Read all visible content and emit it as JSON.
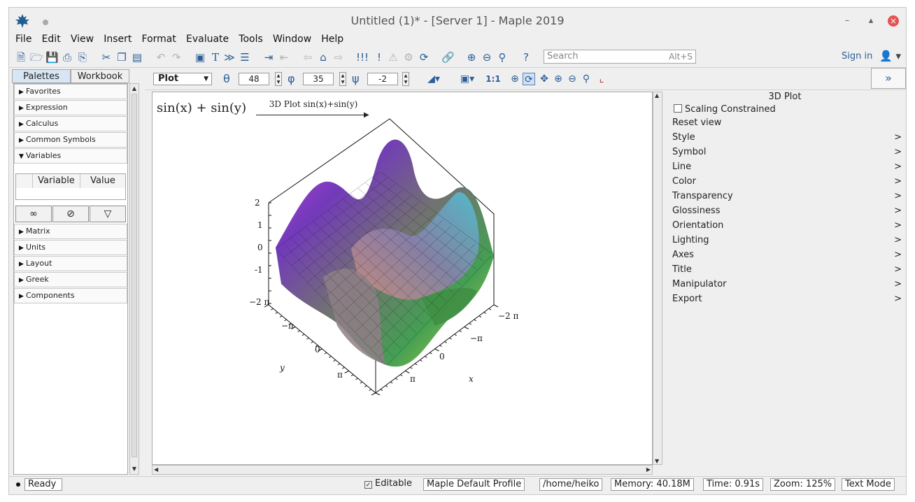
{
  "titlebar": {
    "title": "Untitled (1)* - [Server 1] - Maple 2019"
  },
  "menu": [
    "File",
    "Edit",
    "View",
    "Insert",
    "Format",
    "Evaluate",
    "Tools",
    "Window",
    "Help"
  ],
  "search": {
    "placeholder": "Search",
    "shortcut": "Alt+S"
  },
  "account": {
    "sign_in": "Sign in"
  },
  "palette_tabs": {
    "palettes": "Palettes",
    "workbook": "Workbook"
  },
  "palettes": [
    "Favorites",
    "Expression",
    "Calculus",
    "Common Symbols",
    "Variables",
    "Matrix",
    "Units",
    "Layout",
    "Greek",
    "Components"
  ],
  "variables": {
    "col_variable": "Variable",
    "col_value": "Value"
  },
  "plot_toolbar": {
    "mode": "Plot",
    "theta": "48",
    "phi": "35",
    "psi": "-2",
    "ratio_label": "1:1"
  },
  "document": {
    "expression": "sin(x) + sin(y)",
    "arrow_label": "3D Plot sin(x)+sin(y)"
  },
  "chart_data": {
    "type": "surface",
    "title": "",
    "function": "sin(x)+sin(y)",
    "x_range": [
      -6.283,
      6.283
    ],
    "y_range": [
      -6.283,
      6.283
    ],
    "z_range": [
      -2,
      2
    ],
    "z_ticks": [
      "2",
      "1",
      "0",
      "-1"
    ],
    "x_ticks": [
      "−2 π",
      "−π",
      "0",
      "π"
    ],
    "y_ticks": [
      "−2 π",
      "−π",
      "0",
      "π"
    ],
    "xlabel": "x",
    "ylabel": "y",
    "orientation": {
      "theta": 48,
      "phi": 35,
      "psi": -2
    }
  },
  "context_panel": {
    "title": "3D Plot",
    "scaling": "Scaling Constrained",
    "reset": "Reset view",
    "items": [
      "Style",
      "Symbol",
      "Line",
      "Color",
      "Transparency",
      "Glossiness",
      "Orientation",
      "Lighting",
      "Axes",
      "Title",
      "Manipulator",
      "Export"
    ],
    "chevron": ">"
  },
  "status": {
    "ready": "Ready",
    "editable": "Editable",
    "profile": "Maple Default Profile",
    "path": "/home/heiko",
    "memory": "Memory: 40.18M",
    "time": "Time: 0.91s",
    "zoom": "Zoom: 125%",
    "mode": "Text Mode"
  }
}
